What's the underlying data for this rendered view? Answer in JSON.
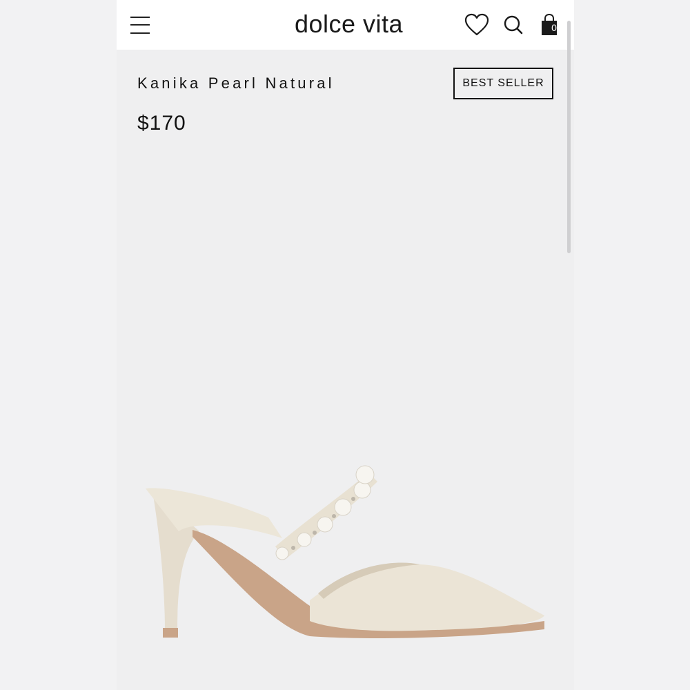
{
  "header": {
    "brand": "dolce vita",
    "cart_count": "0",
    "icons": [
      "menu-icon",
      "heart-icon",
      "search-icon",
      "shopping-bag-icon"
    ]
  },
  "product": {
    "name": "Kanika Pearl Natural",
    "badge": "BEST SELLER",
    "price": "$170",
    "image": "pearl-strap-pointed-toe-mule"
  },
  "colors": {
    "header_bg": "#ffffff",
    "page_bg": "#efeff0",
    "text": "#111111",
    "shoe": "#ebe4d6",
    "sole": "#c9a488"
  }
}
